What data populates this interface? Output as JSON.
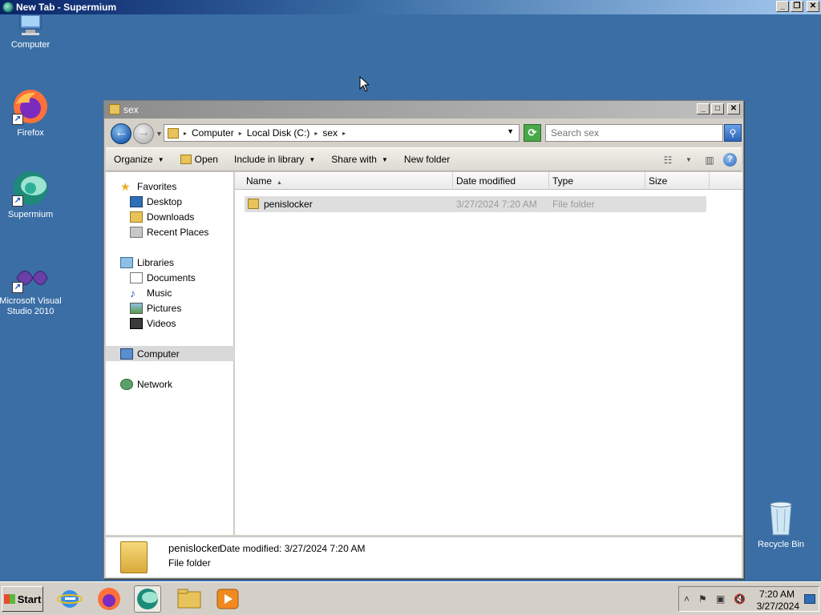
{
  "top_window": {
    "title": "New Tab - Supermium"
  },
  "desktop": {
    "icons": [
      {
        "label": "Computer"
      },
      {
        "label": "Firefox"
      },
      {
        "label": "Supermium"
      },
      {
        "label": "Microsoft Visual Studio 2010"
      },
      {
        "label": "Recycle Bin"
      }
    ]
  },
  "explorer": {
    "title": "sex",
    "address": {
      "crumbs": [
        "Computer",
        "Local Disk (C:)",
        "sex"
      ]
    },
    "search": {
      "placeholder": "Search sex"
    },
    "toolbar": {
      "organize": "Organize",
      "open": "Open",
      "include_in_library": "Include in library",
      "share_with": "Share with",
      "new_folder": "New folder"
    },
    "nav": {
      "favorites": "Favorites",
      "desktop": "Desktop",
      "downloads": "Downloads",
      "recent_places": "Recent Places",
      "libraries": "Libraries",
      "documents": "Documents",
      "music": "Music",
      "pictures": "Pictures",
      "videos": "Videos",
      "computer": "Computer",
      "network": "Network"
    },
    "columns": {
      "name": "Name",
      "date_modified": "Date modified",
      "type": "Type",
      "size": "Size"
    },
    "files": [
      {
        "name": "penislocker",
        "date_modified": "3/27/2024 7:20 AM",
        "type": "File folder"
      }
    ],
    "details": {
      "name": "penislocker",
      "meta": "Date modified: 3/27/2024 7:20 AM",
      "type": "File folder"
    }
  },
  "taskbar": {
    "start": "Start",
    "clock_time": "7:20 AM",
    "clock_date": "3/27/2024"
  }
}
